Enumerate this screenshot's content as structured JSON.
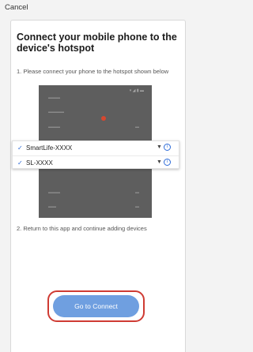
{
  "header": {
    "cancel_label": "Cancel"
  },
  "main": {
    "title": "Connect your mobile phone to the device's hotspot",
    "step1": "1. Please connect your phone to the hotspot shown below",
    "step2": "2. Return to this app and continue adding devices",
    "wifi_networks": [
      {
        "name": "SmartLife-XXXX",
        "checked": true,
        "signal_icon": "wifi-icon",
        "info_icon": "info-icon"
      },
      {
        "name": "SL-XXXX",
        "checked": true,
        "signal_icon": "wifi-icon",
        "info_icon": "info-icon"
      }
    ],
    "connect_button_label": "Go to Connect"
  },
  "colors": {
    "accent": "#2d6bd8",
    "button": "#6f9fe0",
    "highlight_outline": "#cf3b33",
    "screenshot_bg": "#5e5e5e"
  }
}
